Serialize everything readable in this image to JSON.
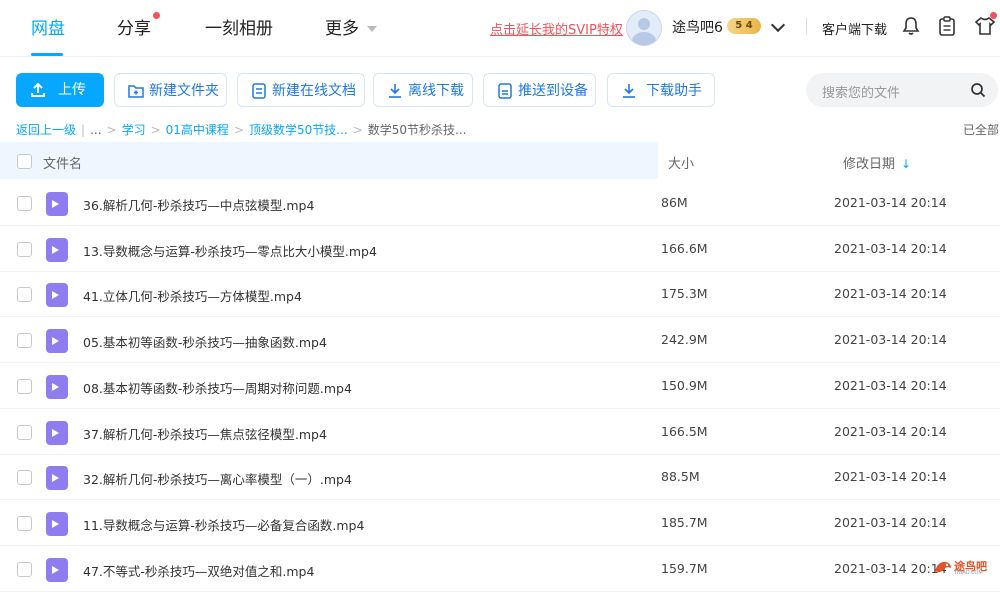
{
  "nav": {
    "items": [
      {
        "label": "网盘",
        "active": true
      },
      {
        "label": "分享",
        "badge": true
      },
      {
        "label": "一刻相册"
      },
      {
        "label": "更多"
      }
    ],
    "svip_link": "点击延长我的SVIP特权",
    "username": "途鸟吧6",
    "vip_level": "5 4",
    "client_download": "客户端下载",
    "icons": [
      "bell-icon",
      "clipboard-icon",
      "shirt-icon"
    ]
  },
  "toolbar": {
    "upload": "上传",
    "new_folder": "新建文件夹",
    "new_doc": "新建在线文档",
    "offline_download": "离线下载",
    "push_device": "推送到设备",
    "download_helper": "下载助手",
    "search_placeholder": "搜索您的文件"
  },
  "breadcrumb": {
    "back": "返回上一级",
    "ellipsis": "...",
    "items": [
      "学习",
      "01高中课程",
      "顶级数学50节技..."
    ],
    "current": "数学50节秒杀技...",
    "right": "已全部"
  },
  "table": {
    "headers": {
      "name": "文件名",
      "size": "大小",
      "date": "修改日期"
    },
    "rows": [
      {
        "name": "36.解析几何-秒杀技巧—中点弦模型.mp4",
        "size": "86M",
        "date": "2021-03-14 20:14"
      },
      {
        "name": "13.导数概念与运算-秒杀技巧—零点比大小模型.mp4",
        "size": "166.6M",
        "date": "2021-03-14 20:14"
      },
      {
        "name": "41.立体几何-秒杀技巧—方体模型.mp4",
        "size": "175.3M",
        "date": "2021-03-14 20:14"
      },
      {
        "name": "05.基本初等函数-秒杀技巧—抽象函数.mp4",
        "size": "242.9M",
        "date": "2021-03-14 20:14"
      },
      {
        "name": "08.基本初等函数-秒杀技巧—周期对称问题.mp4",
        "size": "150.9M",
        "date": "2021-03-14 20:14"
      },
      {
        "name": "37.解析几何-秒杀技巧—焦点弦径模型.mp4",
        "size": "166.5M",
        "date": "2021-03-14 20:14"
      },
      {
        "name": "32.解析几何-秒杀技巧—离心率模型（一）.mp4",
        "size": "88.5M",
        "date": "2021-03-14 20:14"
      },
      {
        "name": "11.导数概念与运算-秒杀技巧—必备复合函数.mp4",
        "size": "185.7M",
        "date": "2021-03-14 20:14"
      },
      {
        "name": "47.不等式-秒杀技巧—双绝对值之和.mp4",
        "size": "159.7M",
        "date": "2021-03-14 20:14"
      }
    ]
  },
  "watermark": {
    "text": "途鸟吧",
    "sub": "TNIAO.COM"
  },
  "colors": {
    "accent": "#06a7ff",
    "red": "#f5505a",
    "video_icon": "#8f7df0"
  }
}
